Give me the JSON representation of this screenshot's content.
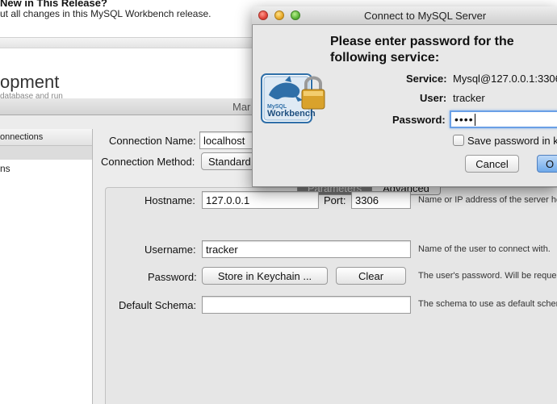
{
  "release_banner": {
    "whats_new": "New in This Release?",
    "changes": "ut all changes in this MySQL Workbench release."
  },
  "bg_heading": "opment",
  "bg_subtext": "database and run",
  "manager_title": "Mar",
  "sidebar": {
    "header": "onnections",
    "item": "ns"
  },
  "connection": {
    "name_label": "Connection Name:",
    "name_value": "localhost",
    "method_label": "Connection Method:",
    "method_value": "Standard"
  },
  "tabs": [
    {
      "label": "Parameters",
      "active": true
    },
    {
      "label": "Advanced",
      "active": false
    }
  ],
  "params": {
    "hostname_label": "Hostname:",
    "hostname_value": "127.0.0.1",
    "port_label": "Port:",
    "port_value": "3306",
    "hostname_hint": "Name or IP address of the server ho",
    "username_label": "Username:",
    "username_value": "tracker",
    "username_hint": "Name of the user to connect with.",
    "password_label": "Password:",
    "store_keychain_label": "Store in Keychain ...",
    "clear_label": "Clear",
    "password_hint": "The user's password. Will be reques",
    "schema_label": "Default Schema:",
    "schema_value": "",
    "schema_hint": "The schema to use as default schem"
  },
  "dialog": {
    "title": "Connect to MySQL Server",
    "prompt": "Please enter password for the following service:",
    "service_label": "Service:",
    "service_value": "Mysql@127.0.0.1:3306",
    "user_label": "User:",
    "user_value": "tracker",
    "password_label": "Password:",
    "password_masked": "••••",
    "save_password_label": "Save password in ke",
    "save_password_checked": false,
    "cancel_label": "Cancel",
    "ok_label": "O"
  },
  "logo": {
    "brand_small": "MySQL",
    "brand_large": "Workbench",
    "icon": "dolphin-lock-icon"
  },
  "colors": {
    "focus_ring": "#6aa0e6",
    "default_button": "#6fa9ea",
    "logo_blue": "#2f6fa8"
  }
}
